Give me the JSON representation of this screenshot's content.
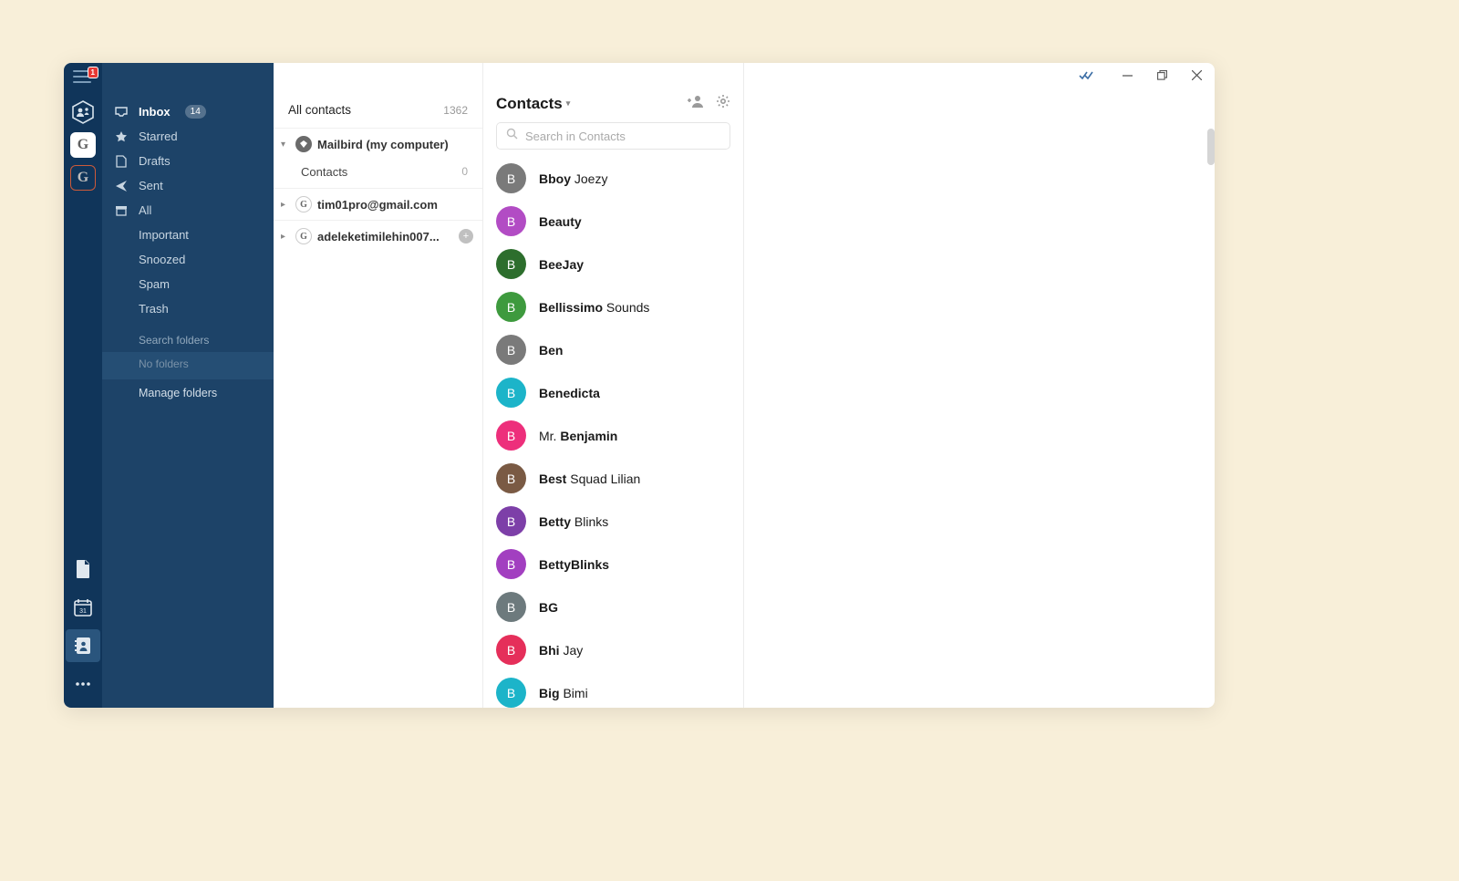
{
  "hamburger_badge": "1",
  "rail": {
    "g1_letter": "G",
    "g2_letter": "G"
  },
  "folders": {
    "inbox": "Inbox",
    "inbox_count": "14",
    "starred": "Starred",
    "drafts": "Drafts",
    "sent": "Sent",
    "all": "All",
    "important": "Important",
    "snoozed": "Snoozed",
    "spam": "Spam",
    "trash": "Trash",
    "search_folders": "Search folders",
    "no_folders": "No folders",
    "manage_folders": "Manage folders"
  },
  "accounts": {
    "all_contacts": "All contacts",
    "all_count": "1362",
    "mailbird": "Mailbird (my computer)",
    "contacts_label": "Contacts",
    "contacts_count": "0",
    "tim": "tim01pro@gmail.com",
    "adeleke": "adeleketimilehin007...",
    "g_letter": "G"
  },
  "contacts_header": {
    "title": "Contacts",
    "search_placeholder": "Search in Contacts"
  },
  "contacts": [
    {
      "letter": "B",
      "color": "#7a7a7a",
      "bold": "Bboy",
      "rest": " Joezy"
    },
    {
      "letter": "B",
      "color": "#b24cc4",
      "bold": "Beauty",
      "rest": ""
    },
    {
      "letter": "B",
      "color": "#2d6e2d",
      "bold": "BeeJay",
      "rest": ""
    },
    {
      "letter": "B",
      "color": "#3e9a3e",
      "bold": "Bellissimo",
      "rest": " Sounds"
    },
    {
      "letter": "B",
      "color": "#7a7a7a",
      "bold": "Ben",
      "rest": ""
    },
    {
      "letter": "B",
      "color": "#1cb4c9",
      "bold": "Benedicta",
      "rest": ""
    },
    {
      "letter": "B",
      "color": "#ed2f7b",
      "prefix": "Mr. ",
      "bold": "Benjamin",
      "rest": ""
    },
    {
      "letter": "B",
      "color": "#7a5a44",
      "bold": "Best",
      "rest": " Squad Lilian"
    },
    {
      "letter": "B",
      "color": "#7d3fa8",
      "bold": "Betty",
      "rest": " Blinks"
    },
    {
      "letter": "B",
      "color": "#a23fc0",
      "bold": "BettyBlinks",
      "rest": ""
    },
    {
      "letter": "B",
      "color": "#6d7a7d",
      "bold": "BG",
      "rest": ""
    },
    {
      "letter": "B",
      "color": "#e52f5a",
      "bold": "Bhi",
      "rest": " Jay"
    },
    {
      "letter": "B",
      "color": "#1cb4c9",
      "bold": "Big",
      "rest": " Bimi"
    }
  ]
}
